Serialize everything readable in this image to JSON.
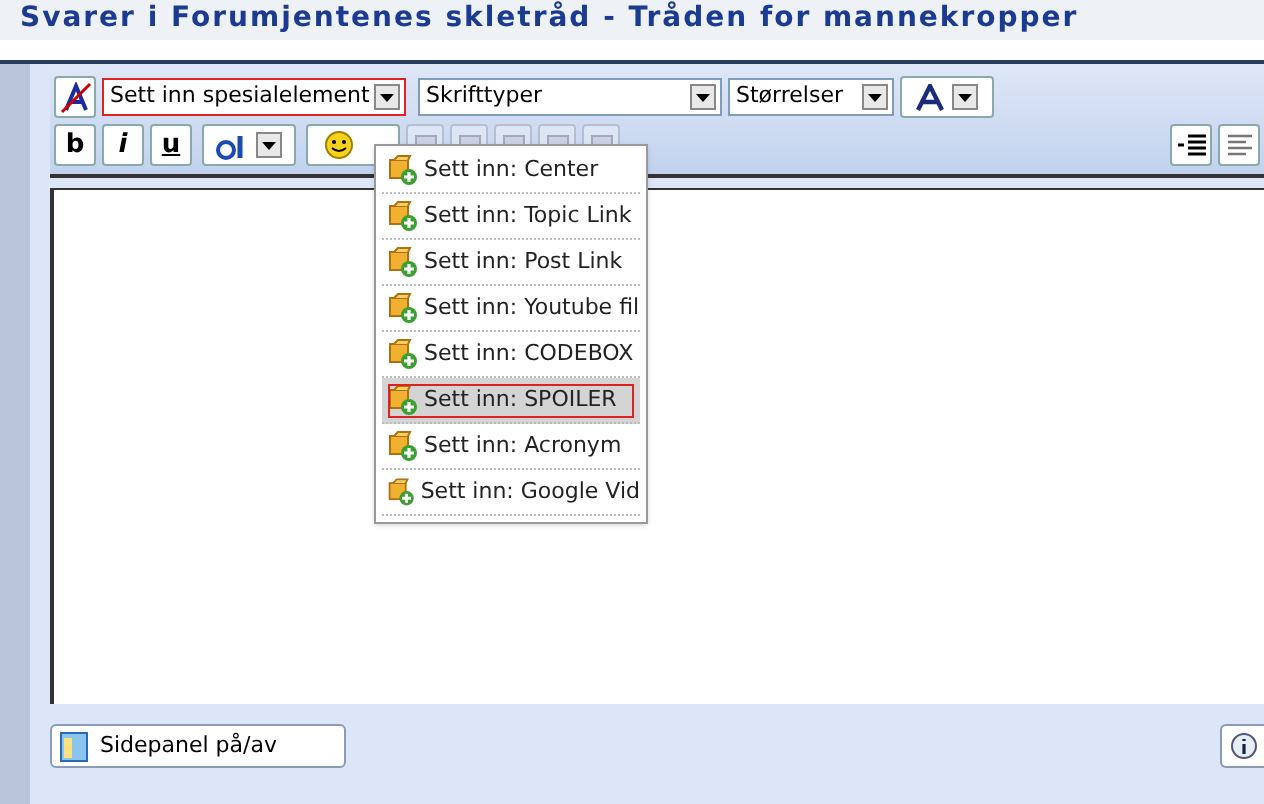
{
  "window": {
    "title": "Svarer i Forumjentenes skletråd - Tråden for mannekropper"
  },
  "toolbar": {
    "special_select": {
      "value": "Sett inn spesialelement",
      "focused": true
    },
    "font_select": {
      "value": "Skrifttyper"
    },
    "size_select": {
      "value": "Størrelser"
    },
    "format_buttons": [
      {
        "label": "b",
        "kind": "bold"
      },
      {
        "label": "i",
        "kind": "italic"
      },
      {
        "label": "u",
        "kind": "underline"
      }
    ]
  },
  "menu": {
    "items": [
      {
        "label": "Sett inn: Center",
        "selected": false
      },
      {
        "label": "Sett inn: Topic Link",
        "selected": false
      },
      {
        "label": "Sett inn: Post Link",
        "selected": false
      },
      {
        "label": "Sett inn: Youtube fil",
        "selected": false
      },
      {
        "label": "Sett inn: CODEBOX",
        "selected": false
      },
      {
        "label": "Sett inn: SPOILER",
        "selected": true
      },
      {
        "label": "Sett inn: Acronym",
        "selected": false
      },
      {
        "label": "Sett inn: Google Vid",
        "selected": false
      }
    ]
  },
  "footer": {
    "sidepanel_button": "Sidepanel på/av"
  }
}
